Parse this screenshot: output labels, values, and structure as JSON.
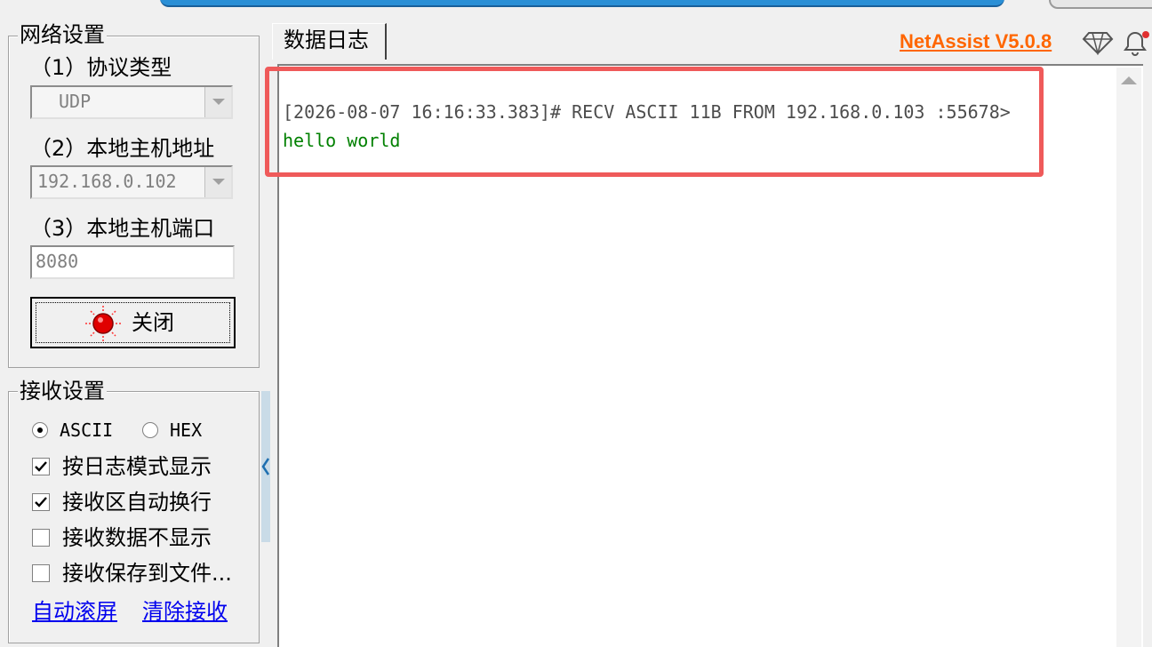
{
  "network_settings": {
    "title": "网络设置",
    "protocol_label": "（1）协议类型",
    "protocol_value": "UDP",
    "local_ip_label": "（2）本地主机地址",
    "local_ip_value": "192.168.0.102",
    "local_port_label": "（3）本地主机端口",
    "local_port_value": "8080",
    "close_button": "关闭"
  },
  "receive_settings": {
    "title": "接收设置",
    "radio_ascii": "ASCII",
    "radio_hex": "HEX",
    "options": [
      {
        "label": "按日志模式显示",
        "checked": true
      },
      {
        "label": "接收区自动换行",
        "checked": true
      },
      {
        "label": "接收数据不显示",
        "checked": false
      },
      {
        "label": "接收保存到文件...",
        "checked": false
      }
    ],
    "link_auto_scroll": "自动滚屏",
    "link_clear": "清除接收"
  },
  "log_tab": {
    "label": "数据日志"
  },
  "brand": {
    "name": "NetAssist V5.0.8",
    "color": "#ff6600"
  },
  "log": {
    "header": "[2026-08-07 16:16:33.383]# RECV ASCII 11B FROM 192.168.0.103 :55678>",
    "message": "hello world",
    "message_color": "#008000",
    "highlight_color": "#ef5a5a"
  }
}
